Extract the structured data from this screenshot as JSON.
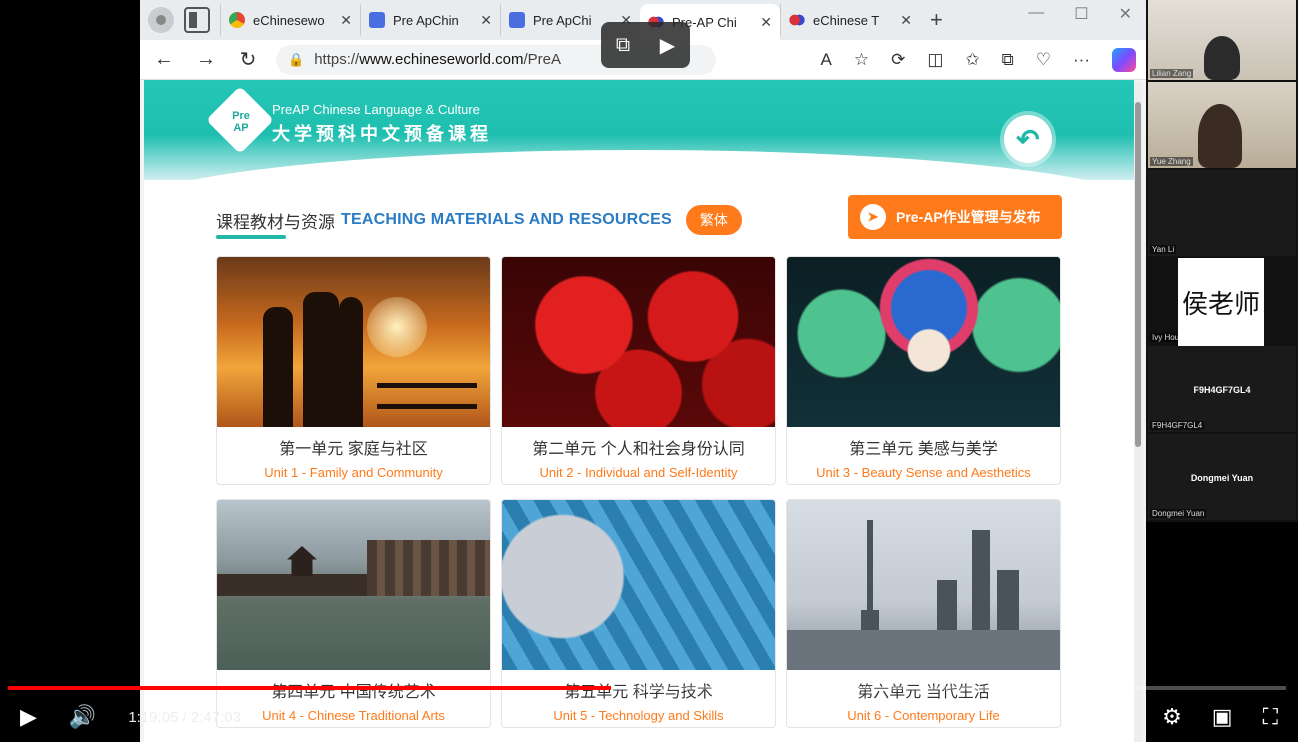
{
  "browser": {
    "tabs": [
      {
        "label": "eChinesewo",
        "fav": "g",
        "active": false
      },
      {
        "label": "Pre ApChin",
        "fav": "doc",
        "active": false
      },
      {
        "label": "Pre ApChi",
        "fav": "doc",
        "active": false
      },
      {
        "label": "Pre-AP Chi",
        "fav": "ec",
        "active": true
      },
      {
        "label": "eChinese T",
        "fav": "ec",
        "active": false
      }
    ],
    "url_prefix": "https://",
    "url_domain": "www.echineseworld.com",
    "url_path": "/PreA"
  },
  "page": {
    "brand_en": "PreAP Chinese Language & Culture",
    "brand_zh": "大学预科中文预备课程",
    "logo_text": "Pre AP",
    "section_zh": "课程教材与资源",
    "section_en": "TEACHING MATERIALS AND RESOURCES",
    "pill": "繁体",
    "assign_button": "Pre-AP作业管理与发布",
    "units": [
      {
        "zh": "第一单元 家庭与社区",
        "en": "Unit 1 - Family and Community"
      },
      {
        "zh": "第二单元 个人和社会身份认同",
        "en": "Unit 2 - Individual and Self-Identity"
      },
      {
        "zh": "第三单元 美感与美学",
        "en": "Unit 3 - Beauty Sense and Aesthetics"
      },
      {
        "zh": "第四单元 中国传统艺术",
        "en": "Unit 4 - Chinese Traditional Arts"
      },
      {
        "zh": "第五单元 科学与技术",
        "en": "Unit 5 - Technology and Skills"
      },
      {
        "zh": "第六单元 当代生活",
        "en": "Unit 6 - Contemporary Life"
      }
    ]
  },
  "player": {
    "time": "1:19:05 / 2:47:03",
    "progress": 0.472
  },
  "zoom": {
    "p1": "Lilian Zang",
    "p2": "Yue Zhang",
    "p3": "Yan Li",
    "p4": "Ivy Hou",
    "p4_caption": "侯老师",
    "p5_center": "F9H4GF7GL4",
    "p5": "F9H4GF7GL4",
    "p6_center": "Dongmei Yuan",
    "p6": "Dongmei Yuan"
  }
}
